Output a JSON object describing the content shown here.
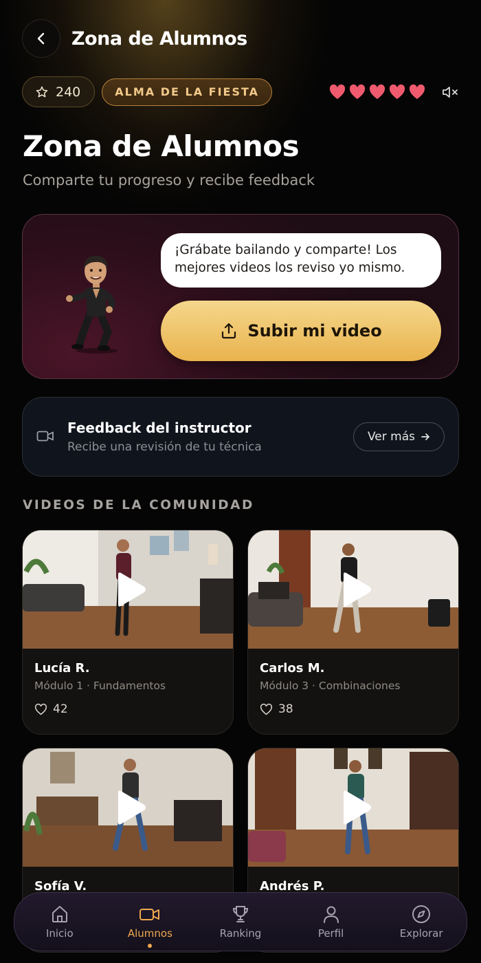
{
  "header": {
    "title": "Zona de Alumnos"
  },
  "status": {
    "points": "240",
    "badge": "ALMA DE LA FIESTA",
    "lives": 5
  },
  "page": {
    "title": "Zona de Alumnos",
    "subtitle": "Comparte tu progreso y recibe feedback"
  },
  "hero": {
    "message": "¡Grábate bailando y comparte! Los mejores videos los reviso yo mismo.",
    "upload_label": "Subir mi video"
  },
  "feedback": {
    "title": "Feedback del instructor",
    "subtitle": "Recibe una revisión de tu técnica",
    "button_label": "Ver más"
  },
  "community": {
    "section_title": "VIDEOS DE LA COMUNIDAD",
    "videos": [
      {
        "name": "Lucía R.",
        "module": "Módulo 1 · Fundamentos",
        "likes": "42"
      },
      {
        "name": "Carlos M.",
        "module": "Módulo 3 · Combinaciones",
        "likes": "38"
      },
      {
        "name": "Sofía V.",
        "module": "",
        "likes": ""
      },
      {
        "name": "Andrés P.",
        "module": "",
        "likes": ""
      }
    ]
  },
  "nav": {
    "items": [
      {
        "label": "Inicio",
        "icon": "home-icon"
      },
      {
        "label": "Alumnos",
        "icon": "video-camera-icon",
        "active": true
      },
      {
        "label": "Ranking",
        "icon": "trophy-icon"
      },
      {
        "label": "Perfil",
        "icon": "user-icon"
      },
      {
        "label": "Explorar",
        "icon": "compass-icon"
      }
    ]
  },
  "colors": {
    "accent": "#f0a94e",
    "gold": "#e9b34d",
    "heart": "#f05a6e",
    "background": "#050505"
  }
}
